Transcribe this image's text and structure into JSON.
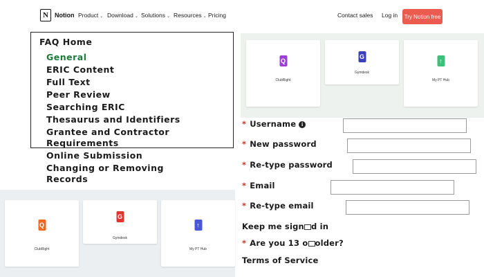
{
  "nav": {
    "logo_text": "Notion",
    "logo_glyph": "N",
    "items": [
      {
        "label": "Product",
        "chev": "⌄"
      },
      {
        "label": "Download",
        "chev": "⌄"
      },
      {
        "label": "Solutions",
        "chev": "⌄"
      },
      {
        "label": "Resources",
        "chev": "⌄"
      },
      {
        "label": "Pricing"
      }
    ],
    "contact_sales": "Contact sales",
    "login": "Log in",
    "cta": "Try Notion free"
  },
  "faq": {
    "title": "FAQ Home",
    "items": [
      "General",
      "ERIC Content",
      "Full Text",
      "Peer Review",
      "Searching ERIC",
      "Thesaurus and Identifiers",
      "Grantee and Contractor",
      "Requirements",
      "Online Submission",
      "Changing or Removing",
      "Records"
    ],
    "active_color": "#1f7a3a"
  },
  "apps_top": [
    {
      "name": "ClubRight",
      "glyph": "Q",
      "color": "#9b3fd6"
    },
    {
      "name": "Gymdesk",
      "glyph": "G",
      "color": "#3b3fb8"
    },
    {
      "name": "My PT Hub",
      "glyph": "↑",
      "color": "#3ec07a"
    }
  ],
  "apps_bottom": [
    {
      "name": "ClubRight",
      "glyph": "Q",
      "color": "#ef6a1f"
    },
    {
      "name": "Gymdesk",
      "glyph": "G",
      "color": "#e0342f"
    },
    {
      "name": "My PT Hub",
      "glyph": "↑",
      "color": "#4a56d8"
    }
  ],
  "form": {
    "required_mark": "*",
    "username": "Username",
    "info_glyph": "i",
    "new_password": "New password",
    "retype_password": "Re-type password",
    "email": "Email",
    "retype_email": "Re-type email",
    "keep_signed_in_a": "Keep me sign",
    "keep_signed_in_b": "d in",
    "age_a": "Are you 13 o",
    "age_b": "older?",
    "terms": "Terms of Service"
  },
  "colors": {
    "cta_bg": "#eb5b4f",
    "required": "#c0392b",
    "panel_top": "#eef2ee",
    "panel_bottom": "#eceff1"
  }
}
